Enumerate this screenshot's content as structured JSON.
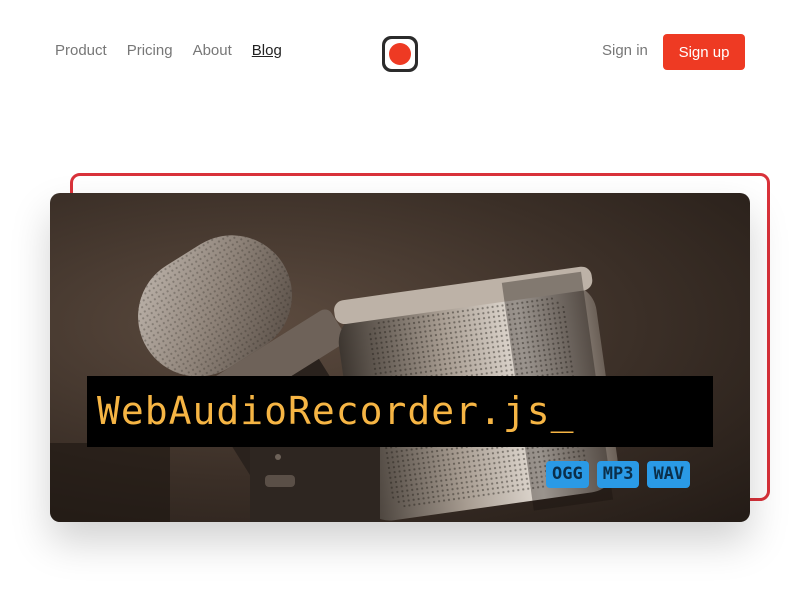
{
  "nav": {
    "links": [
      "Product",
      "Pricing",
      "About",
      "Blog"
    ],
    "active": "Blog",
    "sign_in": "Sign in",
    "sign_up": "Sign up"
  },
  "brand": {
    "logo_icon": "record-icon",
    "accent_color": "#ee3a23"
  },
  "hero": {
    "title": "WebAudioRecorder.js_",
    "formats": [
      "OGG",
      "MP3",
      "WAV"
    ],
    "image": "microphone-photo"
  }
}
